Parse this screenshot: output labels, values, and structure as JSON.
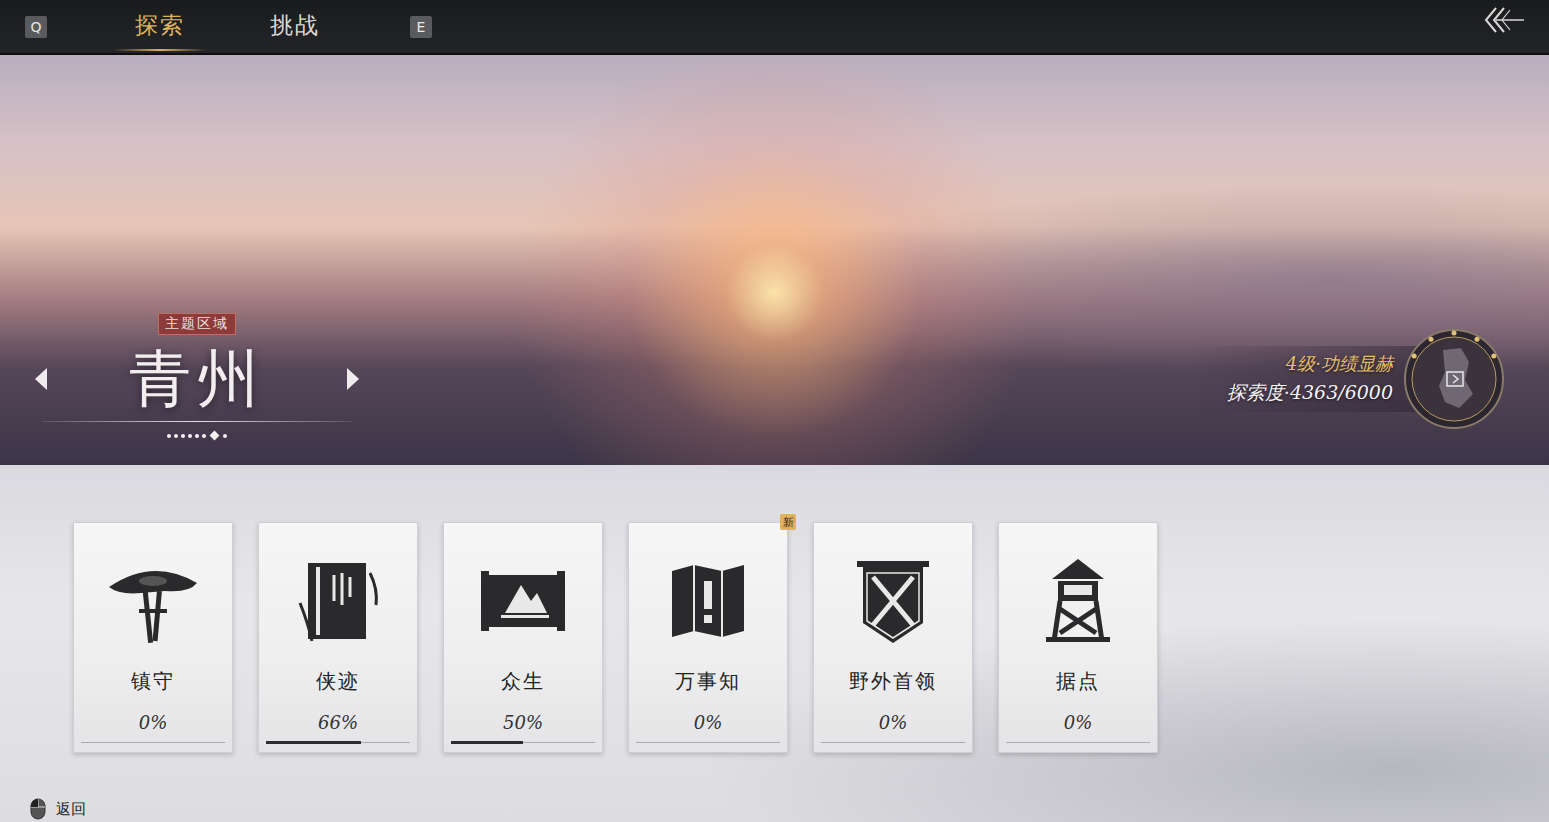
{
  "top_bar": {
    "prev_key": "Q",
    "next_key": "E",
    "tabs": [
      {
        "label": "探索",
        "selected": true
      },
      {
        "label": "挑战",
        "selected": false
      }
    ]
  },
  "region": {
    "tag": "主题区域",
    "name": "青州",
    "pages": [
      {
        "selected": false
      },
      {
        "selected": false
      },
      {
        "selected": false
      },
      {
        "selected": false
      },
      {
        "selected": false
      },
      {
        "selected": false
      },
      {
        "selected": true
      },
      {
        "selected": false
      }
    ]
  },
  "rank": {
    "title": "4级·功绩显赫",
    "progress": "探索度·4363/6000"
  },
  "new_badge": "新",
  "cards": [
    {
      "label": "镇守",
      "value": "0%",
      "level": 0,
      "new": false
    },
    {
      "label": "侠迹",
      "value": "66%",
      "level": 0.66,
      "new": false
    },
    {
      "label": "众生",
      "value": "50%",
      "level": 0.5,
      "new": false
    },
    {
      "label": "万事知",
      "value": "0%",
      "level": 0,
      "new": true
    },
    {
      "label": "野外首领",
      "value": "0%",
      "level": 0,
      "new": false
    },
    {
      "label": "据点",
      "value": "0%",
      "level": 0,
      "new": false
    }
  ],
  "footer": {
    "hint": "返回"
  }
}
